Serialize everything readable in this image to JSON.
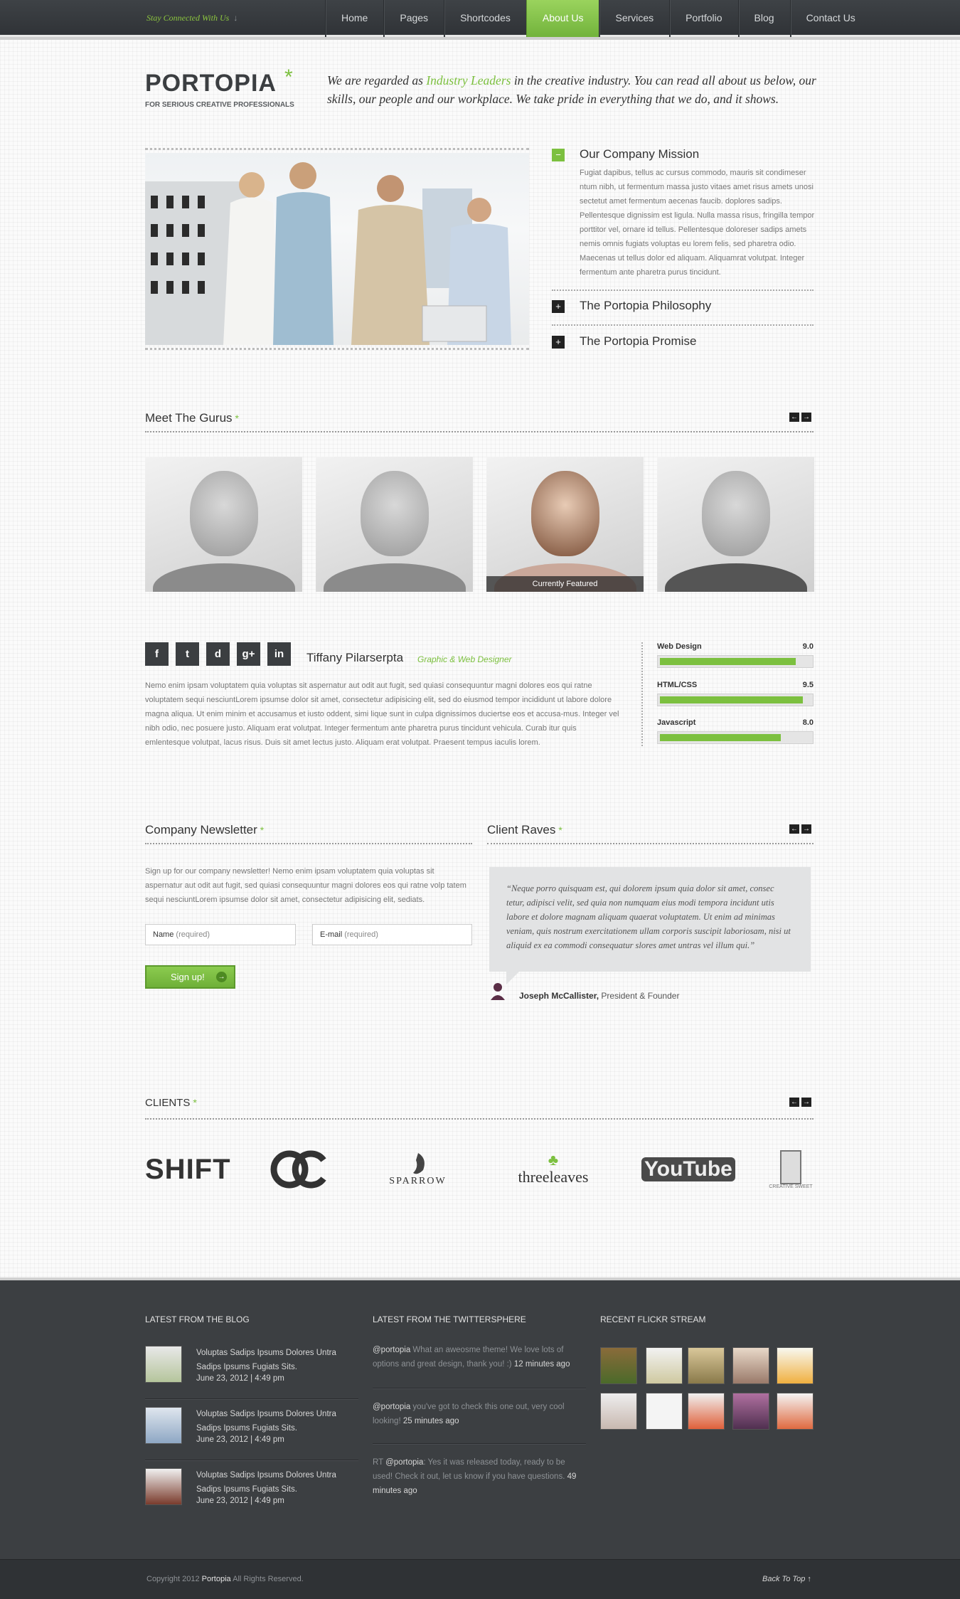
{
  "topbar": {
    "stay_connected": "Stay Connected With Us",
    "arrow": "↓"
  },
  "nav": [
    {
      "label": "Home"
    },
    {
      "label": "Pages"
    },
    {
      "label": "Shortcodes"
    },
    {
      "label": "About Us",
      "active": true
    },
    {
      "label": "Services"
    },
    {
      "label": "Portfolio"
    },
    {
      "label": "Blog"
    },
    {
      "label": "Contact Us"
    }
  ],
  "header": {
    "logo": "PORTOPIA",
    "logo_star": "*",
    "tagline": "FOR SERIOUS CREATIVE PROFESSIONALS",
    "intro_before": "We are regarded as ",
    "intro_highlight": "Industry Leaders",
    "intro_after": " in the creative industry. You can read all about us below, our skills, our people and our workplace. We take pride in everything that we do, and it shows."
  },
  "accordion": [
    {
      "title": "Our Company Mission",
      "icon": "−",
      "open": true,
      "body": "Fugiat dapibus, tellus ac cursus commodo, mauris sit condimeser ntum nibh, ut fermentum massa justo vitaes amet risus amets unosi sectetut amet fermentum aecenas faucib. doplores sadips. Pellentesque dignissim est ligula. Nulla massa risus, fringilla tempor porttitor vel, ornare id tellus. Pellentesque doloreser sadips amets nemis omnis fugiats voluptas eu lorem felis, sed pharetra odio. Maecenas ut tellus dolor ed aliquam. Aliquamrat volutpat. Integer fermentum ante pharetra purus tincidunt."
    },
    {
      "title": "The Portopia Philosophy",
      "icon": "+",
      "open": false
    },
    {
      "title": "The Portopia Promise",
      "icon": "+",
      "open": false
    }
  ],
  "gurus": {
    "title": "Meet The Gurus",
    "star": "*",
    "arrow_prev": "←",
    "arrow_next": "→",
    "featured_label": "Currently Featured",
    "name": "Tiffany Pilarserpta",
    "role": "Graphic & Web Designer",
    "social": [
      "f",
      "t",
      "d",
      "g+",
      "in"
    ],
    "bio": "Nemo enim ipsam voluptatem quia voluptas sit aspernatur aut odit aut fugit, sed quiasi consequuntur magni dolores eos qui ratne voluptatem sequi nesciuntLorem ipsumse dolor sit amet, consectetur adipisicing elit, sed do eiusmod tempor incididunt ut labore dolore magna aliqua. Ut enim minim  et accusamus et iusto oddent, simi lique sunt in culpa dignissimos duciertse eos et accusa-mus. Integer vel nibh odio, nec posuere justo. Aliquam erat volutpat. Integer fermentum ante pharetra purus tincidunt vehicula. Curab itur quis emlentesque volutpat, lacus risus.  Duis sit amet lectus justo. Aliquam erat volutpat. Praesent tempus iaculis lorem.",
    "skills": [
      {
        "label": "Web Design",
        "value": "9.0",
        "fraction": 0.9
      },
      {
        "label": "HTML/CSS",
        "value": "9.5",
        "fraction": 0.95
      },
      {
        "label": "Javascript",
        "value": "8.0",
        "fraction": 0.8
      }
    ]
  },
  "newsletter": {
    "title": "Company Newsletter",
    "star": "*",
    "text": "Sign up for our company newsletter! Nemo enim ipsam voluptatem quia voluptas sit aspernatur aut odit aut fugit, sed quiasi consequuntur magni dolores eos qui ratne volp tatem sequi nesciuntLorem ipsumse dolor sit amet, consectetur adipisicing elit, sediats.",
    "name_label": "Name",
    "email_label": "E-mail",
    "required": "(required)",
    "button": "Sign up!",
    "button_icon": "→"
  },
  "raves": {
    "title": "Client Raves",
    "star": "*",
    "quote": "“Neque porro quisquam est, qui dolorem ipsum quia dolor sit amet, consec tetur, adipisci velit, sed quia non numquam eius modi tempora incidunt utis labore et dolore magnam aliquam quaerat voluptatem. Ut enim ad minimas veniam, quis nostrum exercitationem ullam corporis suscipit laboriosam, nisi ut aliquid ex ea commodi consequatur slores amet untras vel illum qui.”",
    "author": "Joseph McCallister,",
    "author_role": "President & Founder"
  },
  "clients": {
    "title": "CLIENTS",
    "star": "*",
    "logos": [
      "SHIFT",
      "OC",
      "SPARROW",
      "threeleaves",
      "YouTube",
      "CREATIVE SWEET"
    ]
  },
  "footer": {
    "blog_title": "LATEST FROM THE BLOG",
    "twitter_title": "LATEST FROM THE TWITTERSPHERE",
    "flickr_title": "RECENT FLICKR STREAM",
    "posts": [
      {
        "title": "Voluptas Sadips Ipsums Dolores Untra Sadips Ipsums Fugiats Sits.",
        "date": "June 23, 2012   |   4:49 pm"
      },
      {
        "title": "Voluptas Sadips Ipsums Dolores Untra Sadips Ipsums Fugiats Sits.",
        "date": "June 23, 2012   |   4:49 pm"
      },
      {
        "title": "Voluptas Sadips Ipsums Dolores Untra Sadips Ipsums Fugiats Sits.",
        "date": "June 23, 2012   |   4:49 pm"
      }
    ],
    "tweets": [
      {
        "prefix": "",
        "user": "@portopia",
        "text": " What an aweosme theme!  We love lots of options and great design, thank you!  :) ",
        "time": "12 minutes ago"
      },
      {
        "prefix": "",
        "user": "@portopia",
        "text": " you've got to check this one out, very cool looking! ",
        "time": "25 minutes ago"
      },
      {
        "prefix": "RT ",
        "user": "@portopia",
        "text": ": Yes it was released today, ready to be used! Check it out, let us know if you have questions. ",
        "time": "49 minutes ago"
      }
    ],
    "copyright_before": "Copyright 2012 ",
    "copyright_brand": "Portopia",
    "copyright_after": "  All Rights Reserved.",
    "back_to_top": "Back To Top  ↑"
  },
  "colors": {
    "accent": "#7cc03f",
    "dark": "#3c3f42"
  }
}
